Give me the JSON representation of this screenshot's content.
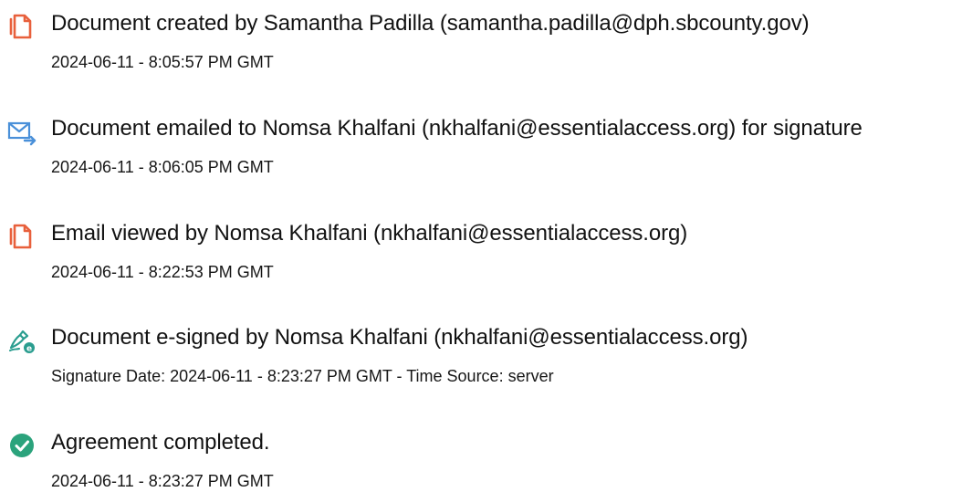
{
  "events": [
    {
      "icon": "document-icon",
      "title": "Document created by Samantha Padilla (samantha.padilla@dph.sbcounty.gov)",
      "timestamp": "2024-06-11 - 8:05:57 PM GMT"
    },
    {
      "icon": "email-sent-icon",
      "title": "Document emailed to Nomsa Khalfani (nkhalfani@essentialaccess.org) for signature",
      "timestamp": "2024-06-11 - 8:06:05 PM GMT"
    },
    {
      "icon": "document-icon",
      "title": "Email viewed by Nomsa Khalfani (nkhalfani@essentialaccess.org)",
      "timestamp": "2024-06-11 - 8:22:53 PM GMT"
    },
    {
      "icon": "e-sign-pen-icon",
      "title": "Document e-signed by Nomsa Khalfani (nkhalfani@essentialaccess.org)",
      "timestamp": "Signature Date: 2024-06-11 - 8:23:27 PM GMT - Time Source: server"
    },
    {
      "icon": "check-circle-icon",
      "title": "Agreement completed.",
      "timestamp": "2024-06-11 - 8:23:27 PM GMT"
    }
  ],
  "colors": {
    "document_icon": "#E8603C",
    "email_icon": "#4A90D9",
    "esign_icon": "#2A9D8F",
    "complete_icon": "#2BA37C"
  }
}
